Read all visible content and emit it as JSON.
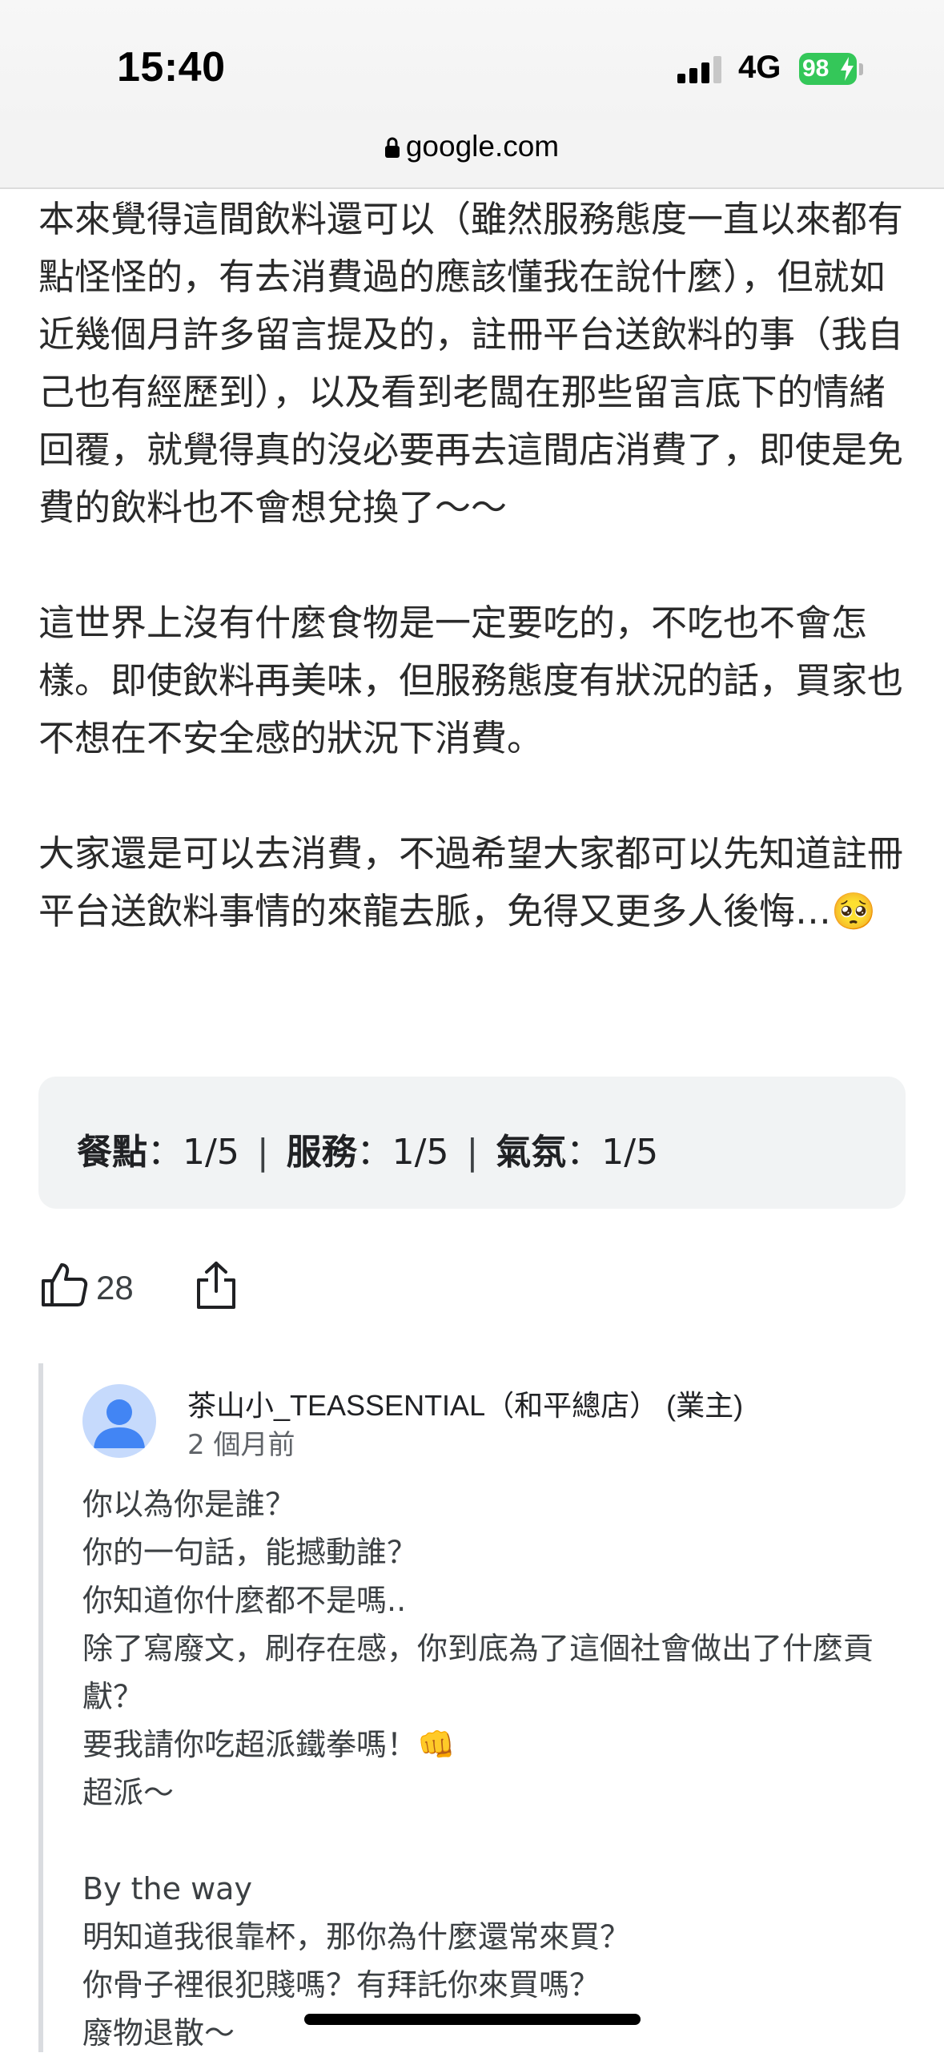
{
  "status_bar": {
    "time": "15:40",
    "network": "4G",
    "battery": "98"
  },
  "url_bar": {
    "domain": "google.com"
  },
  "review": {
    "body": "本來覺得這間飲料還可以（雖然服務態度一直以來都有點怪怪的，有去消費過的應該懂我在說什麼），但就如近幾個月許多留言提及的，註冊平台送飲料的事（我自己也有經歷到），以及看到老闆在那些留言底下的情緒回覆，就覺得真的沒必要再去這間店消費了，即使是免費的飲料也不會想兌換了～～\n\n這世界上沒有什麼食物是一定要吃的，不吃也不會怎樣。即使飲料再美味，但服務態度有狀況的話，買家也不想在不安全感的狀況下消費。\n\n大家還是可以去消費，不過希望大家都可以先知道註冊平台送飲料事情的來龍去脈，免得又更多人後悔…🥺",
    "ratings": {
      "food_label": "餐點",
      "food_value": "：1/5",
      "service_label": "服務",
      "service_value": "：1/5",
      "atmosphere_label": "氣氛",
      "atmosphere_value": "：1/5",
      "separator": "|"
    },
    "like_count": "28"
  },
  "owner_reply": {
    "name": "茶山小_TEASSENTIAL（和平總店） (業主)",
    "time": "2 個月前",
    "body": "你以為你是誰？\n你的一句話，能撼動誰？\n你知道你什麼都不是嗎..\n除了寫廢文，刷存在感，你到底為了這個社會做出了什麼貢獻？\n要我請你吃超派鐵拳嗎！👊\n超派～\n\nBy the way\n明知道我很靠杯，那你為什麼還常來買？\n你骨子裡很犯賤嗎？有拜託你來買嗎？\n廢物退散～"
  },
  "colors": {
    "battery": "#34c759",
    "rating_box": "#f1f3f4",
    "avatar_bg": "#c6dafc",
    "avatar_fg": "#4285f4"
  }
}
